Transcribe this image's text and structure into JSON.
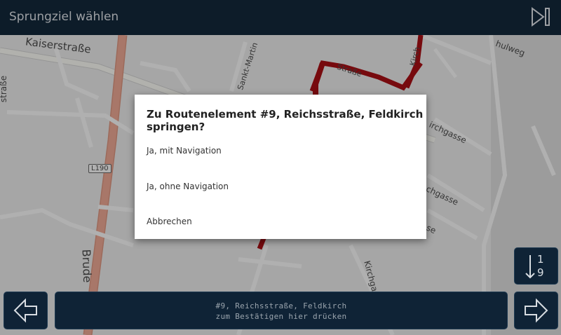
{
  "header": {
    "title": "Sprungziel wählen",
    "skip_icon": "skip-to-end-icon"
  },
  "map": {
    "streets": {
      "kaiserstrasse": "Kaiserstraße",
      "strasse_left": "straße",
      "sankt_martin": "Sankt-Martin",
      "schulweg": "hulweg",
      "kirch_top": "Kirch",
      "strasse_top": "Straße",
      "kirchgasse_1": "irchgasse",
      "kirchgasse_2": "chgasse",
      "kirchgasse_3": "se",
      "kirchgasse_v": "Kirchgas",
      "bruder": "Brude",
      "road_shield": "L190"
    },
    "colors": {
      "route": "#a50f14",
      "main_road": "#e5a593",
      "minor_road": "#f4f4f4",
      "background": "#e7e7e7"
    }
  },
  "dialog": {
    "title": "Zu Routenelement #9, Reichsstraße, Feldkirch springen?",
    "options": [
      "Ja, mit Navigation",
      "Ja, ohne Navigation",
      "Abbrechen"
    ]
  },
  "bottom": {
    "line1": "#9, Reichsstraße, Feldkirch",
    "line2": "zum Bestätigen hier drücken",
    "prev_icon": "arrow-left-icon",
    "next_icon": "arrow-right-icon",
    "sort_icon": "sort-numeric-icon",
    "sort_top": "1",
    "sort_bottom": "9"
  }
}
